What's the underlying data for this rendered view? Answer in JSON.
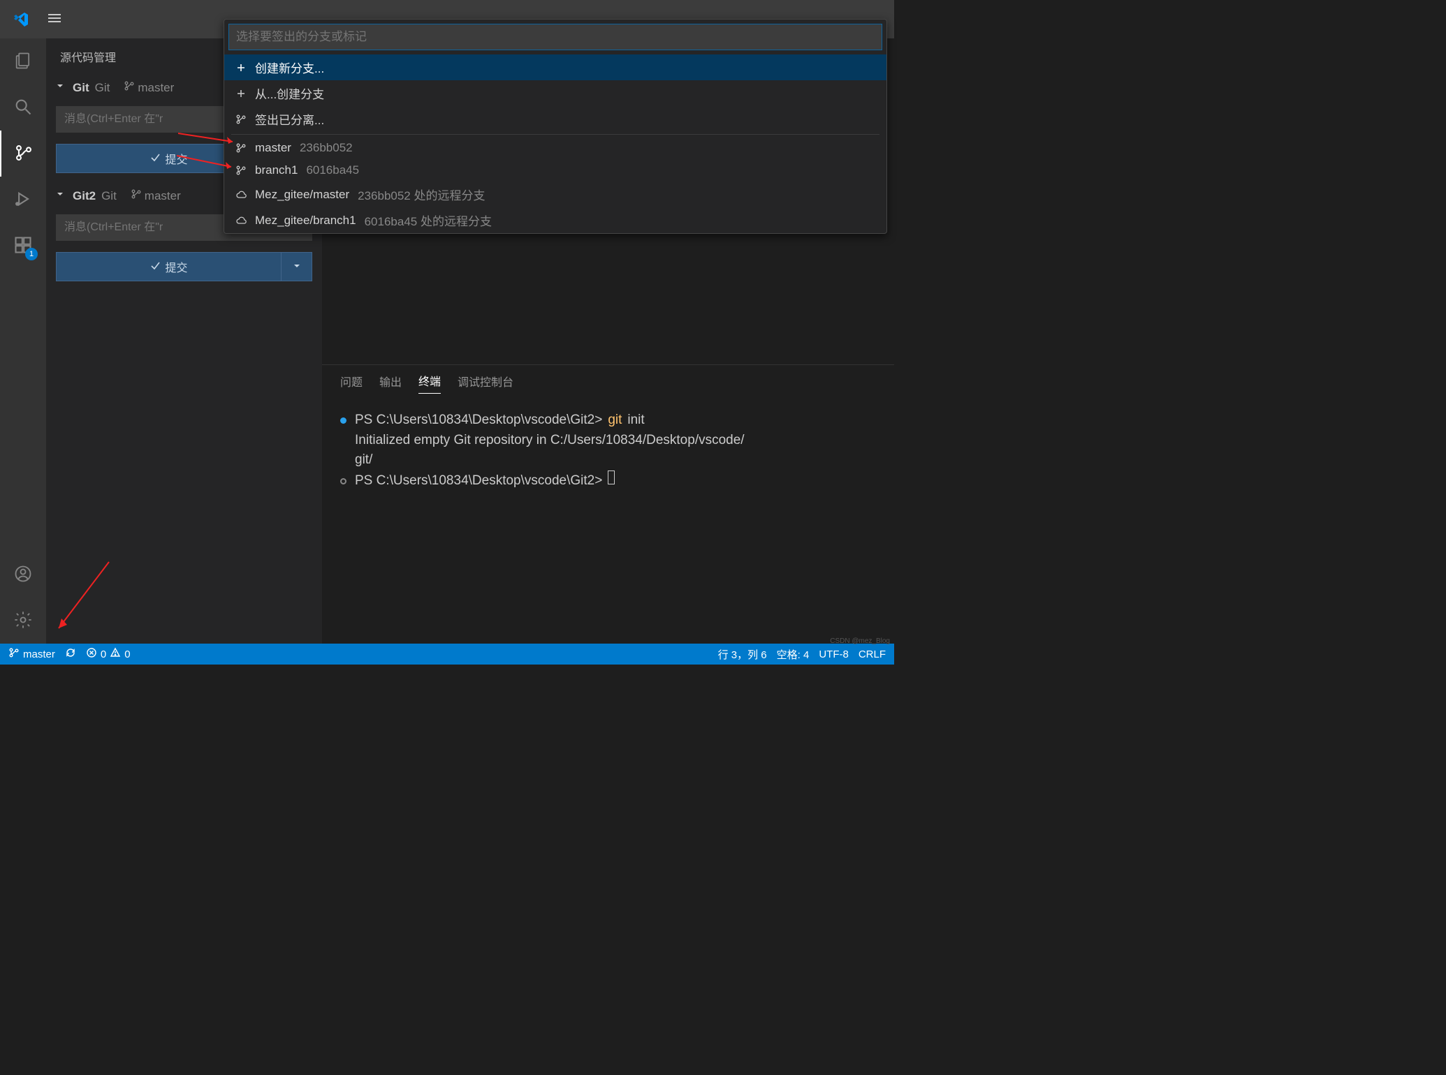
{
  "titlebar": {
    "menu_tooltip": "菜单"
  },
  "activitybar": {
    "ext_badge": "1"
  },
  "sidebar": {
    "title": "源代码管理",
    "repos": [
      {
        "name": "Git",
        "sub": "Git",
        "branch": "master",
        "msg_ph": "消息(Ctrl+Enter 在\"r",
        "commit": "提交"
      },
      {
        "name": "Git2",
        "sub": "Git",
        "branch": "master",
        "msg_ph": "消息(Ctrl+Enter 在\"r",
        "commit": "提交"
      }
    ]
  },
  "quickpick": {
    "placeholder": "选择要签出的分支或标记",
    "top_items": [
      {
        "icon": "plus",
        "label": "创建新分支..."
      },
      {
        "icon": "plus",
        "label": "从...创建分支"
      },
      {
        "icon": "branch",
        "label": "签出已分离..."
      }
    ],
    "items": [
      {
        "icon": "branch",
        "label": "master",
        "desc": "236bb052"
      },
      {
        "icon": "branch",
        "label": "branch1",
        "desc": "6016ba45"
      },
      {
        "icon": "cloud",
        "label": "Mez_gitee/master",
        "desc": "236bb052 处的远程分支"
      },
      {
        "icon": "cloud",
        "label": "Mez_gitee/branch1",
        "desc": "6016ba45 处的远程分支"
      }
    ]
  },
  "panel": {
    "tabs": {
      "problems": "问题",
      "output": "输出",
      "terminal": "终端",
      "debug": "调试控制台"
    },
    "term": {
      "line1_prompt": "PS C:\\Users\\10834\\Desktop\\vscode\\Git2>",
      "line1_cmd": "git",
      "line1_arg": "init",
      "line2": "Initialized empty Git repository in C:/Users/10834/Desktop/vscode/",
      "line3": "git/",
      "line4_prompt": "PS C:\\Users\\10834\\Desktop\\vscode\\Git2>"
    }
  },
  "statusbar": {
    "branch": "master",
    "errors": "0",
    "warnings": "0",
    "line_col": "行 3，列 6",
    "spaces": "空格: 4",
    "encoding": "UTF-8",
    "eol": "CRLF"
  },
  "watermark": "CSDN @mez_Blog"
}
